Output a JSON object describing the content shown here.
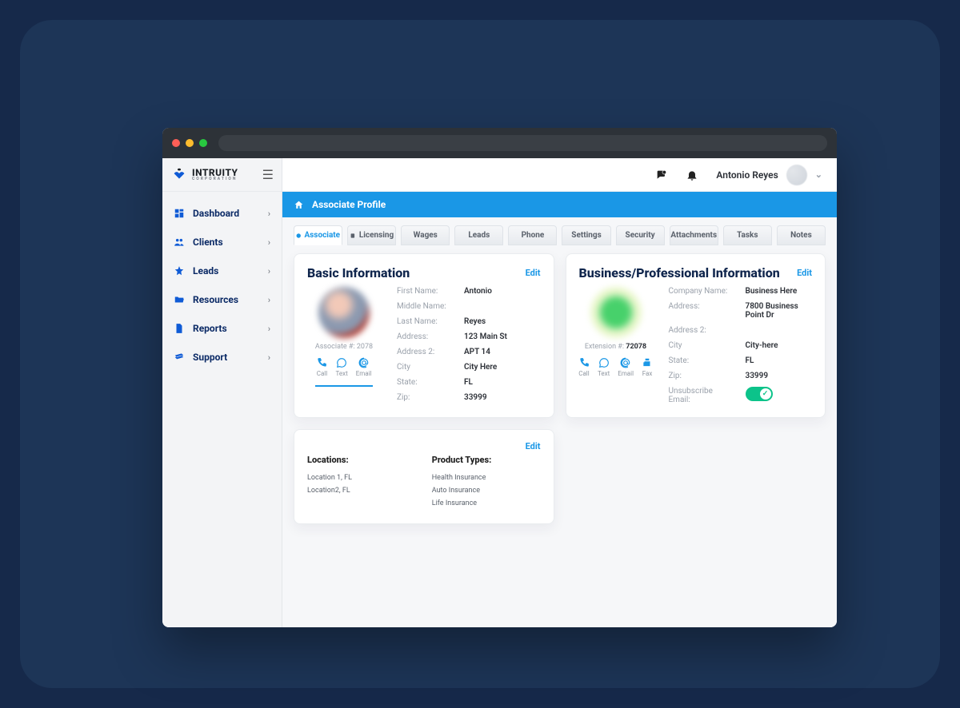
{
  "brand": {
    "name": "INTRUITY",
    "sub": "CORPORATION"
  },
  "header": {
    "user_name": "Antonio Reyes"
  },
  "breadcrumb": {
    "title": "Associate Profile"
  },
  "sidebar": {
    "items": [
      {
        "label": "Dashboard"
      },
      {
        "label": "Clients"
      },
      {
        "label": "Leads"
      },
      {
        "label": "Resources"
      },
      {
        "label": "Reports"
      },
      {
        "label": "Support"
      }
    ]
  },
  "tabs": [
    {
      "label": "Associate"
    },
    {
      "label": "Licensing"
    },
    {
      "label": "Wages"
    },
    {
      "label": "Leads"
    },
    {
      "label": "Phone"
    },
    {
      "label": "Settings"
    },
    {
      "label": "Security"
    },
    {
      "label": "Attachments"
    },
    {
      "label": "Tasks"
    },
    {
      "label": "Notes"
    }
  ],
  "basic": {
    "title": "Basic Information",
    "edit": "Edit",
    "associate_label": "Associate #:",
    "associate_no": "2078",
    "contacts": {
      "call": "Call",
      "text": "Text",
      "email": "Email"
    },
    "fields": {
      "first_name_l": "First Name:",
      "first_name_v": "Antonio",
      "middle_name_l": "Middle Name:",
      "middle_name_v": "",
      "last_name_l": "Last Name:",
      "last_name_v": "Reyes",
      "address_l": "Address:",
      "address_v": "123 Main St",
      "address2_l": "Address 2:",
      "address2_v": "APT 14",
      "city_l": "City",
      "city_v": "City Here",
      "state_l": "State:",
      "state_v": "FL",
      "zip_l": "Zip:",
      "zip_v": "33999"
    }
  },
  "business": {
    "title": "Business/Professional Information",
    "edit": "Edit",
    "extension_label": "Extension #:",
    "extension_no": "72078",
    "contacts": {
      "call": "Call",
      "text": "Text",
      "email": "Email",
      "fax": "Fax"
    },
    "fields": {
      "company_l": "Company Name:",
      "company_v": "Business Here",
      "address_l": "Address:",
      "address_v": "7800 Business Point Dr",
      "address2_l": "Address 2:",
      "address2_v": "",
      "city_l": "City",
      "city_v": "City-here",
      "state_l": "State:",
      "state_v": "FL",
      "zip_l": "Zip:",
      "zip_v": "33999",
      "unsub_l": "Unsubscribe Email:"
    },
    "unsubscribe": true
  },
  "extra": {
    "edit": "Edit",
    "locations_title": "Locations:",
    "locations": [
      "Location 1, FL",
      "Location2, FL"
    ],
    "products_title": "Product Types:",
    "products": [
      "Health Insurance",
      "Auto Insurance",
      "Life Insurance"
    ]
  }
}
